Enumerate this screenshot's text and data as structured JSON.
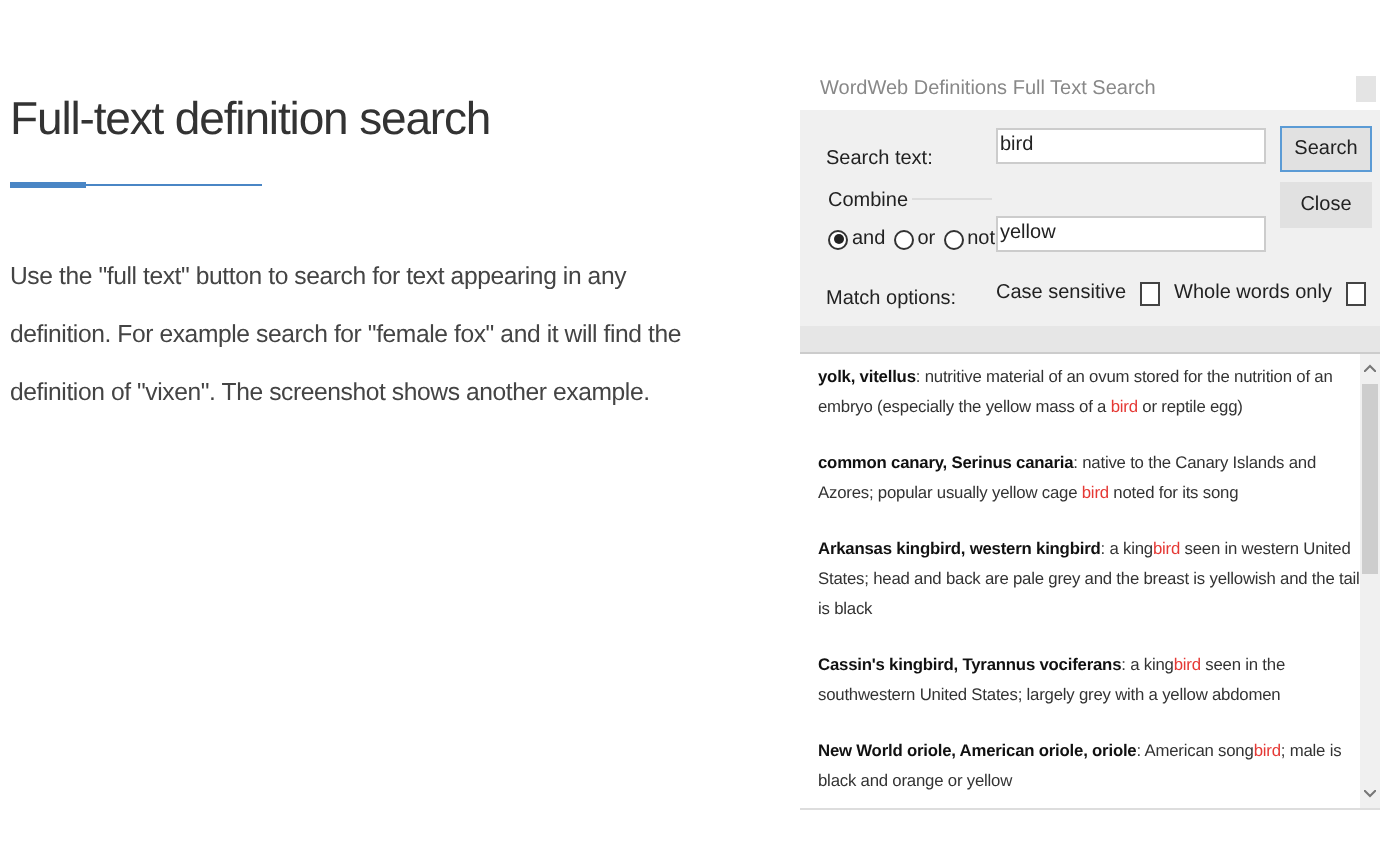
{
  "article": {
    "heading": "Full-text definition search",
    "body": "Use the \"full text\" button to search for text appearing in any definition. For example search for \"female fox\" and it will find the definition of \"vixen\". The screenshot shows another example."
  },
  "dialog": {
    "title": "WordWeb Definitions Full Text Search",
    "search_label": "Search text:",
    "search_value": "bird",
    "combine_label": "Combine",
    "combine_options": [
      {
        "label": "and",
        "selected": true
      },
      {
        "label": "or",
        "selected": false
      },
      {
        "label": "not",
        "selected": false
      }
    ],
    "second_value": "yellow",
    "buttons": [
      "Search",
      "Close"
    ],
    "match_label": "Match options:",
    "match_options": [
      {
        "label": "Case sensitive",
        "checked": false
      },
      {
        "label": "Whole words only",
        "checked": false
      }
    ],
    "results": [
      {
        "headword": "yolk, vitellus",
        "parts": [
          {
            "text": ": nutritive material of an ovum stored for the nutrition of an embryo (especially the yellow mass of a ",
            "highlight": false
          },
          {
            "text": "bird",
            "highlight": true
          },
          {
            "text": " or reptile egg)",
            "highlight": false
          }
        ]
      },
      {
        "headword": "common canary, Serinus canaria",
        "parts": [
          {
            "text": ": native to the Canary Islands and Azores; popular usually yellow cage ",
            "highlight": false
          },
          {
            "text": "bird",
            "highlight": true
          },
          {
            "text": " noted for its song",
            "highlight": false
          }
        ]
      },
      {
        "headword": "Arkansas kingbird, western kingbird",
        "parts": [
          {
            "text": ": a king",
            "highlight": false
          },
          {
            "text": "bird",
            "highlight": true
          },
          {
            "text": " seen in western United States; head and back are pale grey and the breast is yellowish and the tail is black",
            "highlight": false
          }
        ]
      },
      {
        "headword": "Cassin's kingbird, Tyrannus vociferans",
        "parts": [
          {
            "text": ": a king",
            "highlight": false
          },
          {
            "text": "bird",
            "highlight": true
          },
          {
            "text": " seen in the southwestern United States; largely grey with a yellow abdomen",
            "highlight": false
          }
        ]
      },
      {
        "headword": "New World oriole, American oriole, oriole",
        "parts": [
          {
            "text": ": American song",
            "highlight": false
          },
          {
            "text": "bird",
            "highlight": true
          },
          {
            "text": "; male is black and orange or yellow",
            "highlight": false
          }
        ]
      }
    ]
  }
}
